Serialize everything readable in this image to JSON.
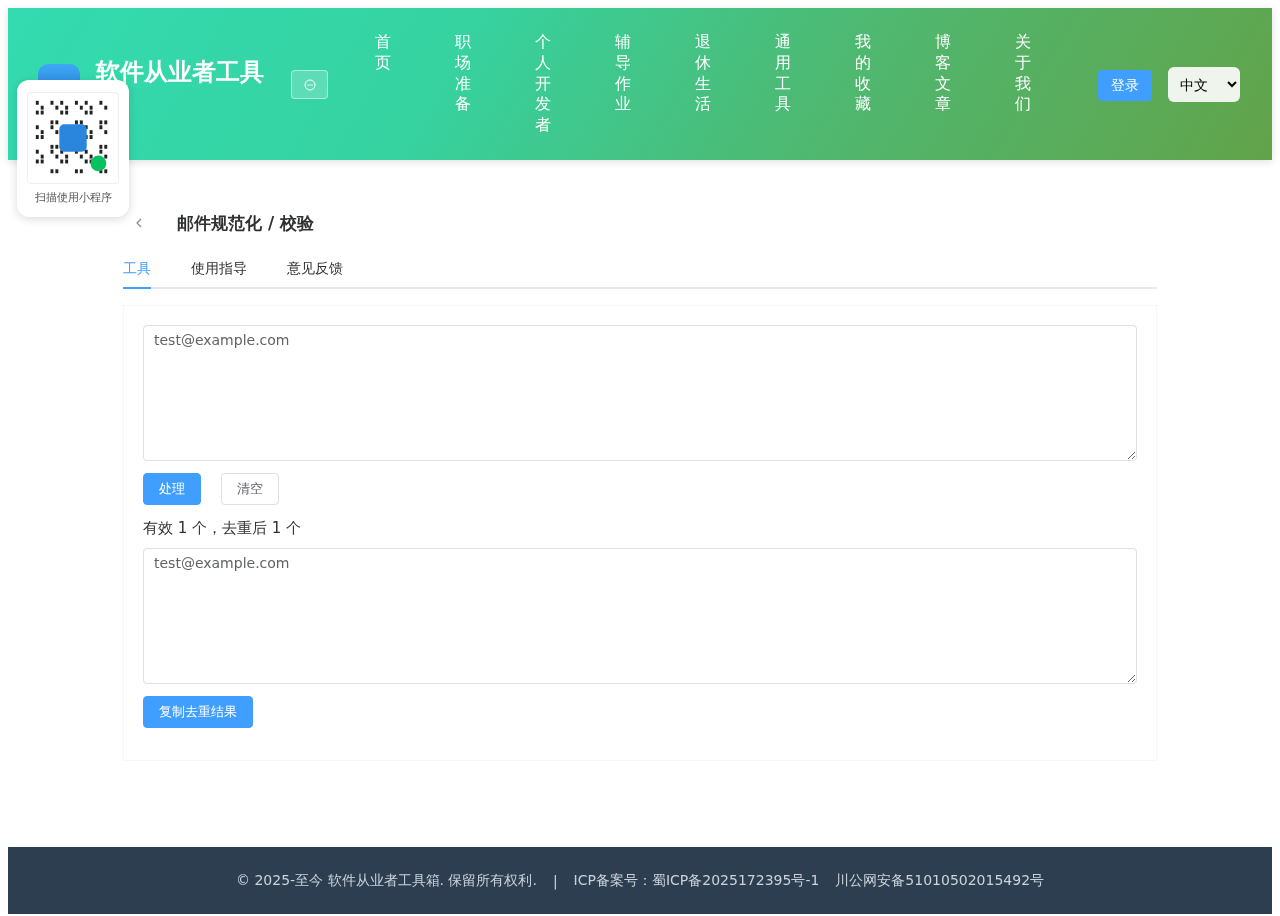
{
  "header": {
    "site_title": "软件从业者工具",
    "nav": [
      {
        "label": "首页"
      },
      {
        "label": "职场准备"
      },
      {
        "label": "个人开发者"
      },
      {
        "label": "辅导作业"
      },
      {
        "label": "退休生活"
      },
      {
        "label": "通用工具"
      },
      {
        "label": "我的收藏"
      },
      {
        "label": "博客文章"
      },
      {
        "label": "关于我们"
      }
    ],
    "login_button": "登录",
    "language_select": "中文"
  },
  "qr_popup": {
    "caption": "扫描使用小程序"
  },
  "page": {
    "title": "邮件规范化 / 校验",
    "tabs": [
      {
        "label": "工具",
        "selected": true
      },
      {
        "label": "使用指导",
        "selected": false
      },
      {
        "label": "意见反馈",
        "selected": false
      }
    ],
    "input": {
      "value": "test@example.com"
    },
    "buttons": [
      {
        "label": "处理",
        "kind": "primary"
      },
      {
        "label": "清空",
        "kind": "plain"
      }
    ],
    "result_summary": "有效 1 个，去重后 1 个",
    "output": {
      "value": "test@example.com"
    },
    "copy_button": "复制去重结果"
  },
  "footer": {
    "copyright": "© 2025-至今 软件从业者工具箱. 保留所有权利.",
    "separator": "|",
    "icp": "ICP备案号：蜀ICP备2025172395号-1",
    "police": "川公网安备51010502015492号"
  }
}
